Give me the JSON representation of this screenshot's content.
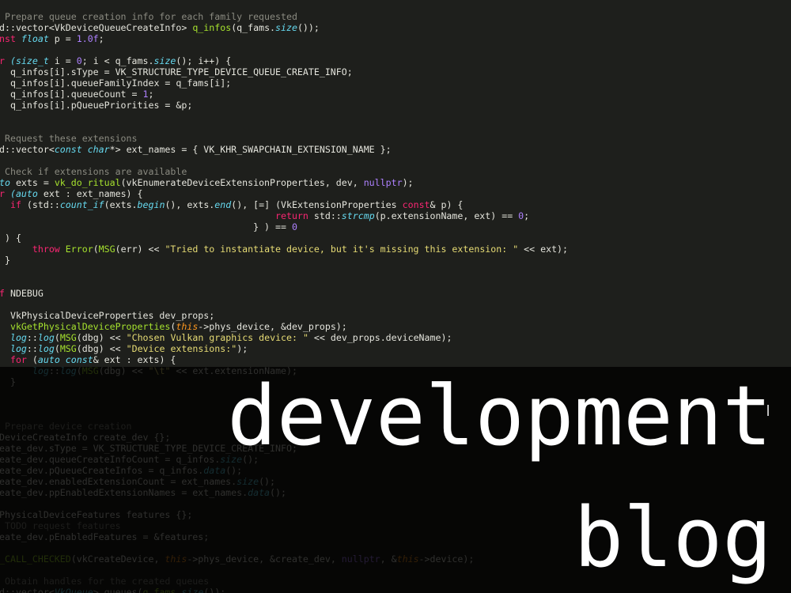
{
  "code_lines": [
    [
      {
        "t": " Prepare queue creation info for each family requested",
        "c": "c"
      }
    ],
    [
      {
        "t": "d::vector<VkDeviceQueueCreateInfo> "
      },
      {
        "t": "q_infos",
        "c": "f"
      },
      {
        "t": "(q_fams."
      },
      {
        "t": "size",
        "c": "t"
      },
      {
        "t": "());"
      }
    ],
    [
      {
        "t": "nst ",
        "c": "k"
      },
      {
        "t": "float",
        "c": "t"
      },
      {
        "t": " p = "
      },
      {
        "t": "1.0f",
        "c": "n"
      },
      {
        "t": ";"
      }
    ],
    [
      {
        "t": ""
      }
    ],
    [
      {
        "t": "r ",
        "c": "k"
      },
      {
        "t": "(size_t",
        "c": "t"
      },
      {
        "t": " i = "
      },
      {
        "t": "0",
        "c": "n"
      },
      {
        "t": "; i < q_fams."
      },
      {
        "t": "size",
        "c": "t"
      },
      {
        "t": "(); i++) {"
      }
    ],
    [
      {
        "t": "  q_infos[i].sType = VK_STRUCTURE_TYPE_DEVICE_QUEUE_CREATE_INFO;"
      }
    ],
    [
      {
        "t": "  q_infos[i].queueFamilyIndex = q_fams[i];"
      }
    ],
    [
      {
        "t": "  q_infos[i].queueCount = "
      },
      {
        "t": "1",
        "c": "n"
      },
      {
        "t": ";"
      }
    ],
    [
      {
        "t": "  q_infos[i].pQueuePriorities = &p;"
      }
    ],
    [
      {
        "t": ""
      }
    ],
    [
      {
        "t": ""
      }
    ],
    [
      {
        "t": " Request these extensions",
        "c": "c"
      }
    ],
    [
      {
        "t": "d::vector<"
      },
      {
        "t": "const char",
        "c": "t"
      },
      {
        "t": "*> ext_names = { VK_KHR_SWAPCHAIN_EXTENSION_NAME };"
      }
    ],
    [
      {
        "t": ""
      }
    ],
    [
      {
        "t": " Check if extensions are available",
        "c": "c"
      }
    ],
    [
      {
        "t": "to",
        "c": "t"
      },
      {
        "t": " exts = "
      },
      {
        "t": "vk_do_ritual",
        "c": "f"
      },
      {
        "t": "(vkEnumerateDeviceExtensionProperties, dev, "
      },
      {
        "t": "nullptr",
        "c": "n"
      },
      {
        "t": ");"
      }
    ],
    [
      {
        "t": "r ",
        "c": "k"
      },
      {
        "t": "(auto",
        "c": "t"
      },
      {
        "t": " ext : ext_names) {"
      }
    ],
    [
      {
        "t": "  "
      },
      {
        "t": "if",
        "c": "k"
      },
      {
        "t": " (std::"
      },
      {
        "t": "count_if",
        "c": "t"
      },
      {
        "t": "(exts."
      },
      {
        "t": "begin",
        "c": "t"
      },
      {
        "t": "(), exts."
      },
      {
        "t": "end",
        "c": "t"
      },
      {
        "t": "(), [=] (VkExtensionProperties "
      },
      {
        "t": "const",
        "c": "k"
      },
      {
        "t": "& p) {"
      }
    ],
    [
      {
        "t": "                                                  "
      },
      {
        "t": "return",
        "c": "k"
      },
      {
        "t": " std::"
      },
      {
        "t": "strcmp",
        "c": "t"
      },
      {
        "t": "(p.extensionName, ext) == "
      },
      {
        "t": "0",
        "c": "n"
      },
      {
        "t": ";"
      }
    ],
    [
      {
        "t": "                                              } ) == "
      },
      {
        "t": "0",
        "c": "n"
      }
    ],
    [
      {
        "t": " ) {"
      }
    ],
    [
      {
        "t": "      "
      },
      {
        "t": "throw",
        "c": "k"
      },
      {
        "t": " "
      },
      {
        "t": "Error",
        "c": "f"
      },
      {
        "t": "("
      },
      {
        "t": "MSG",
        "c": "f"
      },
      {
        "t": "(err) << "
      },
      {
        "t": "\"Tried to instantiate device, but it's missing this extension: \"",
        "c": "s"
      },
      {
        "t": " << ext);"
      }
    ],
    [
      {
        "t": " }"
      }
    ],
    [
      {
        "t": ""
      }
    ],
    [
      {
        "t": ""
      }
    ],
    [
      {
        "t": "f ",
        "c": "k"
      },
      {
        "t": "NDEBUG"
      }
    ],
    [
      {
        "t": ""
      }
    ],
    [
      {
        "t": "  VkPhysicalDeviceProperties dev_props;"
      }
    ],
    [
      {
        "t": "  "
      },
      {
        "t": "vkGetPhysicalDeviceProperties",
        "c": "f"
      },
      {
        "t": "("
      },
      {
        "t": "this",
        "c": "p"
      },
      {
        "t": "->phys_device, &dev_props);"
      }
    ],
    [
      {
        "t": "  "
      },
      {
        "t": "log",
        "c": "t"
      },
      {
        "t": "::"
      },
      {
        "t": "log",
        "c": "t"
      },
      {
        "t": "("
      },
      {
        "t": "MSG",
        "c": "f"
      },
      {
        "t": "(dbg) << "
      },
      {
        "t": "\"Chosen Vulkan graphics device: \"",
        "c": "s"
      },
      {
        "t": " << dev_props.deviceName);"
      }
    ],
    [
      {
        "t": "  "
      },
      {
        "t": "log",
        "c": "t"
      },
      {
        "t": "::"
      },
      {
        "t": "log",
        "c": "t"
      },
      {
        "t": "("
      },
      {
        "t": "MSG",
        "c": "f"
      },
      {
        "t": "(dbg) << "
      },
      {
        "t": "\"Device extensions:\"",
        "c": "s"
      },
      {
        "t": ");"
      }
    ],
    [
      {
        "t": "  "
      },
      {
        "t": "for",
        "c": "k"
      },
      {
        "t": " ("
      },
      {
        "t": "auto const",
        "c": "t"
      },
      {
        "t": "& ext : exts) {"
      }
    ],
    [
      {
        "t": "      "
      },
      {
        "t": "log",
        "c": "t"
      },
      {
        "t": "::"
      },
      {
        "t": "log",
        "c": "t"
      },
      {
        "t": "("
      },
      {
        "t": "MSG",
        "c": "f"
      },
      {
        "t": "(dbg) << "
      },
      {
        "t": "\"\\t\"",
        "c": "s"
      },
      {
        "t": " << ext.extensionName);"
      }
    ],
    [
      {
        "t": "  }"
      }
    ],
    [
      {
        "t": ""
      }
    ],
    [
      {
        "t": ""
      }
    ],
    [
      {
        "t": ""
      }
    ],
    [
      {
        "t": " Prepare device creation",
        "c": "c"
      }
    ],
    [
      {
        "t": "DeviceCreateInfo create_dev {};"
      }
    ],
    [
      {
        "t": "eate_dev.sType = VK_STRUCTURE_TYPE_DEVICE_CREATE_INFO;"
      }
    ],
    [
      {
        "t": "eate_dev.queueCreateInfoCount = q_infos."
      },
      {
        "t": "size",
        "c": "t"
      },
      {
        "t": "();"
      }
    ],
    [
      {
        "t": "eate_dev.pQueueCreateInfos = q_infos."
      },
      {
        "t": "data",
        "c": "t"
      },
      {
        "t": "();"
      }
    ],
    [
      {
        "t": "eate_dev.enabledExtensionCount = ext_names."
      },
      {
        "t": "size",
        "c": "t"
      },
      {
        "t": "();"
      }
    ],
    [
      {
        "t": "eate_dev.ppEnabledExtensionNames = ext_names."
      },
      {
        "t": "data",
        "c": "t"
      },
      {
        "t": "();"
      }
    ],
    [
      {
        "t": ""
      }
    ],
    [
      {
        "t": "PhysicalDeviceFeatures features {};"
      }
    ],
    [
      {
        "t": " TODO request features",
        "c": "c"
      }
    ],
    [
      {
        "t": "eate_dev.pEnabledFeatures = &features;"
      }
    ],
    [
      {
        "t": ""
      }
    ],
    [
      {
        "t": "_CALL_CHECKED",
        "c": "f"
      },
      {
        "t": "(vkCreateDevice, "
      },
      {
        "t": "this",
        "c": "p"
      },
      {
        "t": "->phys_device, &create_dev, "
      },
      {
        "t": "nullptr",
        "c": "n"
      },
      {
        "t": ", &"
      },
      {
        "t": "this",
        "c": "p"
      },
      {
        "t": "->device);"
      }
    ],
    [
      {
        "t": ""
      }
    ],
    [
      {
        "t": " Obtain handles for the created queues",
        "c": "c"
      }
    ],
    [
      {
        "t": "d::vector<"
      },
      {
        "t": "VkQueue",
        "c": "t"
      },
      {
        "t": "> queues("
      },
      {
        "t": "q_fams",
        "c": "f"
      },
      {
        "t": "."
      },
      {
        "t": "size",
        "c": "t"
      },
      {
        "t": "());"
      }
    ]
  ],
  "banner": {
    "line1": "development",
    "line2": "blog"
  },
  "colors": {
    "background": "#1e1f1c",
    "banner_overlay": "#000000",
    "banner_text": "#ffffff"
  }
}
